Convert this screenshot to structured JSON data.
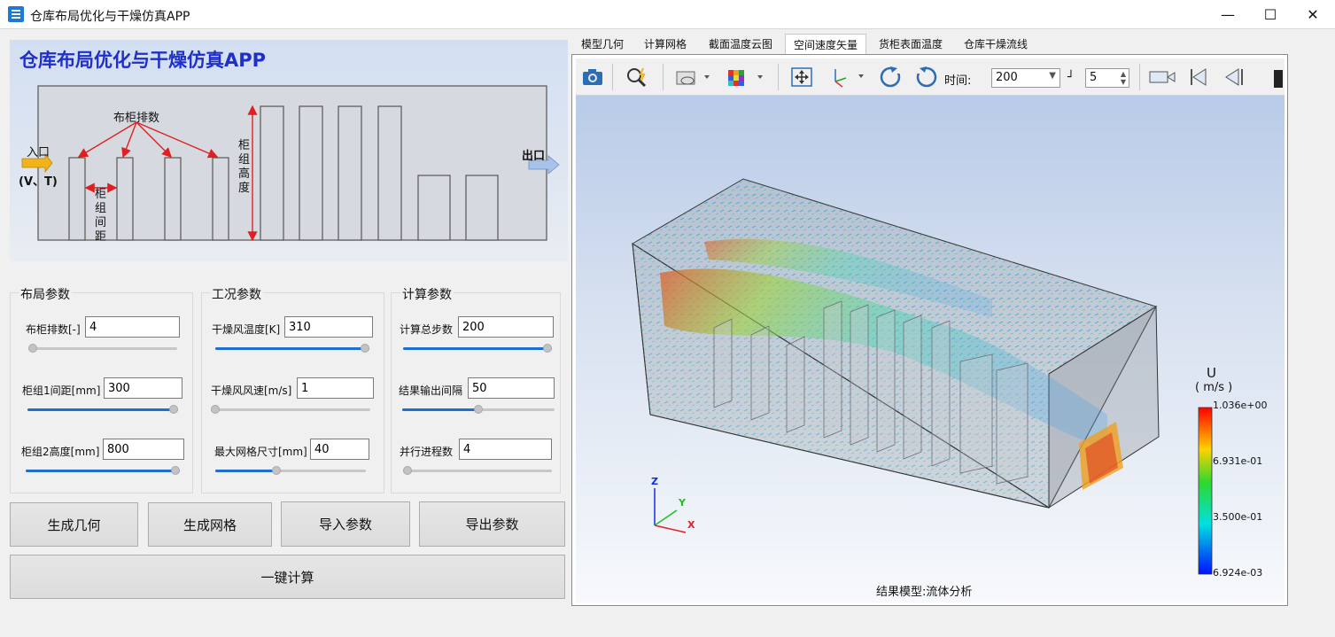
{
  "window": {
    "title": "仓库布局优化与干燥仿真APP",
    "minimize": "—",
    "maximize": "☐",
    "close": "✕"
  },
  "diagram": {
    "heading": "仓库布局优化与干燥仿真APP",
    "label_rows": "布柜排数",
    "label_height": "柜组高度",
    "label_spacing": "柜组间距",
    "label_inlet": "入口",
    "label_inlet_params": "(V、T)",
    "label_outlet": "出口"
  },
  "layout_params": {
    "title": "布局参数",
    "rows_label": "布柜排数[-]",
    "rows_value": "4",
    "rows_level": 0.0,
    "spacing_label": "柜组1间距[mm]",
    "spacing_value": "300",
    "spacing_level": 1.0,
    "height_label": "柜组2高度[mm]",
    "height_value": "800",
    "height_level": 1.0
  },
  "work_params": {
    "title": "工况参数",
    "temp_label": "干燥风温度[K]",
    "temp_value": "310",
    "temp_level": 1.0,
    "speed_label": "干燥风风速[m/s]",
    "speed_value": "1",
    "speed_level": 0.0,
    "mesh_label": "最大网格尺寸[mm]",
    "mesh_value": "40",
    "mesh_level": 0.4
  },
  "calc_params": {
    "title": "计算参数",
    "steps_label": "计算总步数",
    "steps_value": "200",
    "steps_level": 1.0,
    "interval_label": "结果输出间隔",
    "interval_value": "50",
    "interval_level": 0.5,
    "procs_label": "并行进程数",
    "procs_value": "4",
    "procs_level": 0.0
  },
  "buttons": {
    "gen_geometry": "生成几何",
    "gen_mesh": "生成网格",
    "import_params": "导入参数",
    "export_params": "导出参数",
    "one_click_compute": "一键计算"
  },
  "tabs": [
    "模型几何",
    "计算网格",
    "截面温度云图",
    "空间速度矢量",
    "货柜表面温度",
    "仓库干燥流线"
  ],
  "active_tab": 3,
  "toolbar": {
    "time_label": "时间:",
    "time_value": "200",
    "step_value": "5"
  },
  "legend": {
    "title": "U",
    "unit": "( m/s )",
    "max": "1.036e+00",
    "mid_high": "6.931e-01",
    "mid_low": "3.500e-01",
    "min": "6.924e-03"
  },
  "axes": {
    "z": "Z",
    "y": "Y",
    "x": "X"
  },
  "result_caption": "结果模型:流体分析",
  "colors": {
    "accent": "#1f6fd0",
    "heading": "#1e2fcc",
    "arrow": "#e02020"
  }
}
